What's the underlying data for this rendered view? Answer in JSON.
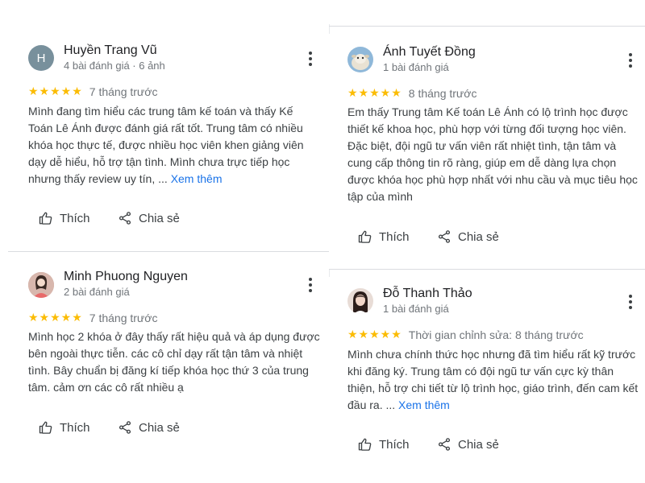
{
  "reviews": [
    {
      "name": "Huyền Trang Vũ",
      "meta": "4 bài đánh giá · 6 ảnh",
      "avatar_letter": "H",
      "stars": "★★★★★",
      "when": "7 tháng trước",
      "text": "Mình đang tìm hiểu các trung tâm kế toán và thấy Kế Toán Lê Ánh được đánh giá rất tốt. Trung tâm có nhiều khóa học thực tế, được nhiều học viên khen giảng viên dạy dễ hiểu, hỗ trợ tận tình. Mình chưa trực tiếp học nhưng thấy review uy tín, ...",
      "more_link": "Xem thêm",
      "like": "Thích",
      "share": "Chia sẻ"
    },
    {
      "name": "Minh Phuong Nguyen",
      "meta": "2 bài đánh giá",
      "stars": "★★★★★",
      "when": "7 tháng trước",
      "text": "Mình học 2 khóa ở đây thấy rất hiệu quả và áp dụng được bên ngoài thực tiễn. các cô chỉ dạy rất tận tâm và nhiệt tình. Bây chuẩn bị đăng kí tiếp khóa học thứ 3 của trung tâm. cảm ơn các cô rất nhiều ạ",
      "like": "Thích",
      "share": "Chia sẻ"
    },
    {
      "name": "Ánh Tuyết Đồng",
      "meta": "1 bài đánh giá",
      "stars": "★★★★★",
      "when": "8 tháng trước",
      "text": "Em thấy Trung tâm Kế toán Lê Ánh có lộ trình học được thiết kế khoa học, phù hợp với từng đối tượng học viên. Đặc biệt, đội ngũ tư vấn viên rất nhiệt tình, tận tâm và cung cấp thông tin rõ ràng, giúp em dễ dàng lựa chọn được khóa học phù hợp nhất với nhu cầu và mục tiêu học tập của mình",
      "like": "Thích",
      "share": "Chia sẻ"
    },
    {
      "name": "Đỗ Thanh Thảo",
      "meta": "1 bài đánh giá",
      "stars": "★★★★★",
      "when": "Thời gian chỉnh sửa: 8 tháng trước",
      "text": "Mình chưa chính thức học nhưng đã tìm hiểu rất kỹ trước khi đăng ký. Trung tâm có đội ngũ tư vấn cực kỳ thân thiện, hỗ trợ chi tiết từ lộ trình học, giáo trình, đến cam kết đầu ra. ...",
      "more_link": "Xem thêm",
      "like": "Thích",
      "share": "Chia sẻ"
    }
  ]
}
